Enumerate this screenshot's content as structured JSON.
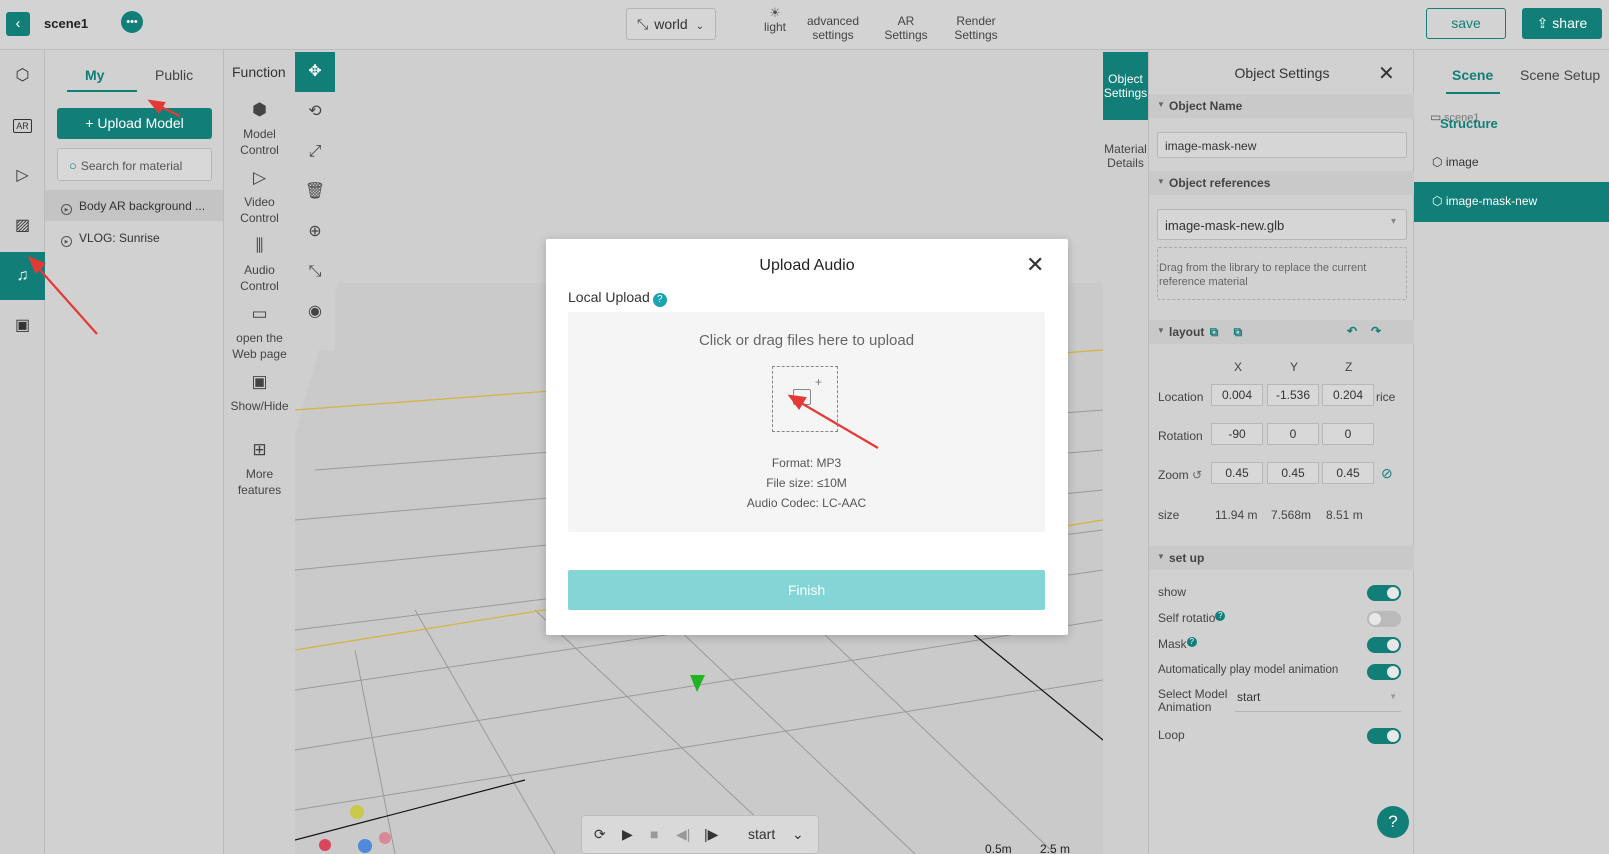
{
  "topbar": {
    "scene_name": "scene1",
    "world_label": "world",
    "tools": [
      {
        "label": "light",
        "icon": "sun-icon"
      },
      {
        "label": "advanced settings",
        "icon": "settings-icon"
      },
      {
        "label": "AR Settings",
        "icon": "ar-icon"
      },
      {
        "label": "Render Settings",
        "icon": "render-icon"
      }
    ],
    "save_label": "save",
    "share_label": "share"
  },
  "left_icons": [
    "cube-icon",
    "ar-icon",
    "video-icon",
    "image-icon",
    "music-icon",
    "gallery-icon"
  ],
  "left_icons_active": "music-icon",
  "library": {
    "tabs": [
      "My",
      "Public"
    ],
    "active_tab": "My",
    "upload_label": "Upload Model",
    "search_placeholder": "Search for material",
    "items": [
      "Body AR background ...",
      "VLOG: Sunrise"
    ]
  },
  "function_panel": {
    "title": "Function",
    "items": [
      {
        "label": "Model Control",
        "icon": "model-icon"
      },
      {
        "label": "Video Control",
        "icon": "video-icon"
      },
      {
        "label": "Audio Control",
        "icon": "sliders-icon"
      },
      {
        "label": "open the Web page",
        "icon": "monitor-icon"
      },
      {
        "label": "Show/Hide",
        "icon": "show-hide-icon"
      },
      {
        "label": "More features",
        "icon": "grid-icon"
      }
    ]
  },
  "tools": [
    "move-icon",
    "rotate-icon",
    "scale-icon",
    "trash-icon",
    "target-icon",
    "collapse-icon",
    "eye-icon"
  ],
  "playbar": {
    "label": "start"
  },
  "scale_labels": [
    "0.5m",
    "2.5 m"
  ],
  "object_tabs": [
    "Object Settings",
    "Material Details"
  ],
  "object_settings": {
    "title": "Object Settings",
    "object_name_header": "Object Name",
    "object_name": "image-mask-new",
    "references_header": "Object references",
    "reference_value": "image-mask-new.glb",
    "drop_hint": "Drag from the library to replace the current reference material",
    "layout_header": "layout",
    "axes": [
      "X",
      "Y",
      "Z"
    ],
    "location_label": "Location",
    "location": [
      "0.004",
      "-1.536",
      "0.204"
    ],
    "location_suffix": "rice",
    "rotation_label": "Rotation",
    "rotation": [
      "-90",
      "0",
      "0"
    ],
    "zoom_label": "Zoom",
    "zoom": [
      "0.45",
      "0.45",
      "0.45"
    ],
    "size_label": "size",
    "size": [
      "11.94 m",
      "7.568m",
      "8.51 m"
    ],
    "setup_header": "set up",
    "show_label": "show",
    "self_rotation_label": "Self rotatio",
    "mask_label": "Mask",
    "auto_play_label": "Automatically play model animation",
    "select_anim_label": "Select Model Animation",
    "select_anim_value": "start",
    "loop_label": "Loop",
    "toggles": {
      "show": true,
      "self_rotation": false,
      "mask": true,
      "auto_play": true,
      "loop": true
    }
  },
  "scene_panel": {
    "tabs": [
      "Scene",
      "Scene Setup"
    ],
    "active_tab": "Scene",
    "overlap_text_a": "scene1",
    "overlap_text_b": "Structure",
    "items": [
      "image",
      "image-mask-new"
    ],
    "selected": "image-mask-new"
  },
  "modal": {
    "title": "Upload Audio",
    "local_upload_label": "Local Upload",
    "hint": "Click or drag files here to upload",
    "format": "Format: MP3",
    "file_size": "File size: ≤10M",
    "codec": "Audio Codec: LC-AAC",
    "finish_label": "Finish"
  },
  "colors": {
    "accent": "#127e78",
    "finish_disabled": "#84d6d6",
    "arrow": "#e53935"
  }
}
